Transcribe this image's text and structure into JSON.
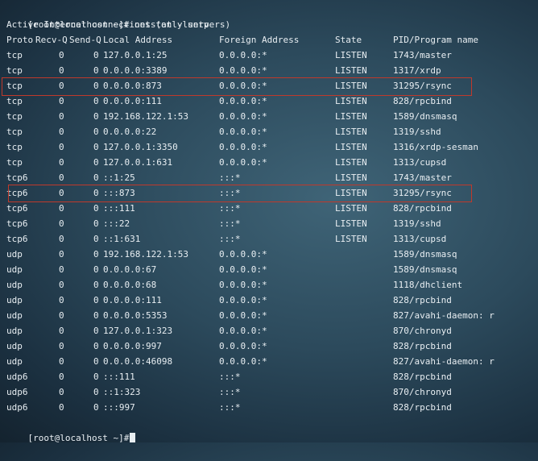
{
  "terminal": {
    "prompt": "[root@localhost ~]# netstat -luntp",
    "subtitle": "Active Internet connections (only servers)",
    "final_prompt": "[root@localhost ~]#",
    "headers": {
      "proto": "Proto",
      "recvq": "Recv-Q",
      "sendq": "Send-Q",
      "local": "Local Address",
      "foreign": "Foreign Address",
      "state": "State",
      "pid": "PID/Program name"
    },
    "rows": [
      {
        "proto": "tcp",
        "recvq": "0",
        "sendq": "0",
        "local": "127.0.0.1:25",
        "foreign": "0.0.0.0:*",
        "state": "LISTEN",
        "pid": "1743/master"
      },
      {
        "proto": "tcp",
        "recvq": "0",
        "sendq": "0",
        "local": "0.0.0.0:3389",
        "foreign": "0.0.0.0:*",
        "state": "LISTEN",
        "pid": "1317/xrdp"
      },
      {
        "proto": "tcp",
        "recvq": "0",
        "sendq": "0",
        "local": "0.0.0.0:873",
        "foreign": "0.0.0.0:*",
        "state": "LISTEN",
        "pid": "31295/rsync"
      },
      {
        "proto": "tcp",
        "recvq": "0",
        "sendq": "0",
        "local": "0.0.0.0:111",
        "foreign": "0.0.0.0:*",
        "state": "LISTEN",
        "pid": "828/rpcbind"
      },
      {
        "proto": "tcp",
        "recvq": "0",
        "sendq": "0",
        "local": "192.168.122.1:53",
        "foreign": "0.0.0.0:*",
        "state": "LISTEN",
        "pid": "1589/dnsmasq"
      },
      {
        "proto": "tcp",
        "recvq": "0",
        "sendq": "0",
        "local": "0.0.0.0:22",
        "foreign": "0.0.0.0:*",
        "state": "LISTEN",
        "pid": "1319/sshd"
      },
      {
        "proto": "tcp",
        "recvq": "0",
        "sendq": "0",
        "local": "127.0.0.1:3350",
        "foreign": "0.0.0.0:*",
        "state": "LISTEN",
        "pid": "1316/xrdp-sesman"
      },
      {
        "proto": "tcp",
        "recvq": "0",
        "sendq": "0",
        "local": "127.0.0.1:631",
        "foreign": "0.0.0.0:*",
        "state": "LISTEN",
        "pid": "1313/cupsd"
      },
      {
        "proto": "tcp6",
        "recvq": "0",
        "sendq": "0",
        "local": "::1:25",
        "foreign": ":::*",
        "state": "LISTEN",
        "pid": "1743/master"
      },
      {
        "proto": "tcp6",
        "recvq": "0",
        "sendq": "0",
        "local": ":::873",
        "foreign": ":::*",
        "state": "LISTEN",
        "pid": "31295/rsync"
      },
      {
        "proto": "tcp6",
        "recvq": "0",
        "sendq": "0",
        "local": ":::111",
        "foreign": ":::*",
        "state": "LISTEN",
        "pid": "828/rpcbind"
      },
      {
        "proto": "tcp6",
        "recvq": "0",
        "sendq": "0",
        "local": ":::22",
        "foreign": ":::*",
        "state": "LISTEN",
        "pid": "1319/sshd"
      },
      {
        "proto": "tcp6",
        "recvq": "0",
        "sendq": "0",
        "local": "::1:631",
        "foreign": ":::*",
        "state": "LISTEN",
        "pid": "1313/cupsd"
      },
      {
        "proto": "udp",
        "recvq": "0",
        "sendq": "0",
        "local": "192.168.122.1:53",
        "foreign": "0.0.0.0:*",
        "state": "",
        "pid": "1589/dnsmasq"
      },
      {
        "proto": "udp",
        "recvq": "0",
        "sendq": "0",
        "local": "0.0.0.0:67",
        "foreign": "0.0.0.0:*",
        "state": "",
        "pid": "1589/dnsmasq"
      },
      {
        "proto": "udp",
        "recvq": "0",
        "sendq": "0",
        "local": "0.0.0.0:68",
        "foreign": "0.0.0.0:*",
        "state": "",
        "pid": "1118/dhclient"
      },
      {
        "proto": "udp",
        "recvq": "0",
        "sendq": "0",
        "local": "0.0.0.0:111",
        "foreign": "0.0.0.0:*",
        "state": "",
        "pid": "828/rpcbind"
      },
      {
        "proto": "udp",
        "recvq": "0",
        "sendq": "0",
        "local": "0.0.0.0:5353",
        "foreign": "0.0.0.0:*",
        "state": "",
        "pid": "827/avahi-daemon: r"
      },
      {
        "proto": "udp",
        "recvq": "0",
        "sendq": "0",
        "local": "127.0.0.1:323",
        "foreign": "0.0.0.0:*",
        "state": "",
        "pid": "870/chronyd"
      },
      {
        "proto": "udp",
        "recvq": "0",
        "sendq": "0",
        "local": "0.0.0.0:997",
        "foreign": "0.0.0.0:*",
        "state": "",
        "pid": "828/rpcbind"
      },
      {
        "proto": "udp",
        "recvq": "0",
        "sendq": "0",
        "local": "0.0.0.0:46098",
        "foreign": "0.0.0.0:*",
        "state": "",
        "pid": "827/avahi-daemon: r"
      },
      {
        "proto": "udp6",
        "recvq": "0",
        "sendq": "0",
        "local": ":::111",
        "foreign": ":::*",
        "state": "",
        "pid": "828/rpcbind"
      },
      {
        "proto": "udp6",
        "recvq": "0",
        "sendq": "0",
        "local": "::1:323",
        "foreign": ":::*",
        "state": "",
        "pid": "870/chronyd"
      },
      {
        "proto": "udp6",
        "recvq": "0",
        "sendq": "0",
        "local": ":::997",
        "foreign": ":::*",
        "state": "",
        "pid": "828/rpcbind"
      }
    ]
  },
  "colors": {
    "text": "#e8eef2",
    "highlight_border": "#c0392b"
  }
}
